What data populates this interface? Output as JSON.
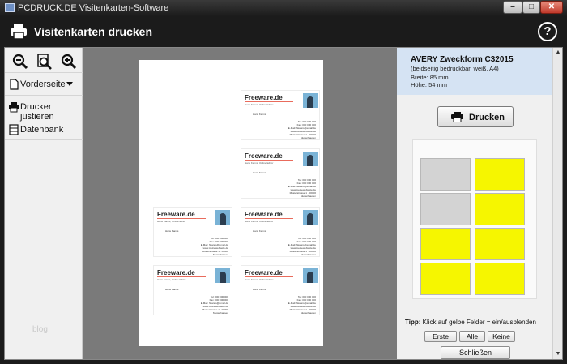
{
  "window": {
    "title": "PCDRUCK.DE Visitenkarten-Software",
    "min_label": "–",
    "max_label": "□",
    "close_label": "✕"
  },
  "header": {
    "title": "Visitenkarten drucken",
    "help_label": "?"
  },
  "sidebar": {
    "zoom_icons": [
      "zoom-out-icon",
      "zoom-fit-icon",
      "zoom-in-icon"
    ],
    "items": [
      {
        "label": "Vorderseite",
        "icon": "page-icon",
        "has_dropdown": true
      },
      {
        "label": "Drucker justieren",
        "icon": "printer-icon"
      },
      {
        "label": "Datenbank",
        "icon": "database-icon"
      }
    ],
    "watermark": "blog"
  },
  "card_template": {
    "title": "Freeware.de",
    "subtitle": "Hans Kanns, Online Editor",
    "name": "Hans Kanns",
    "info_lines": [
      "Tel: 000 000 000",
      "Fax: 000 000 000",
      "E-Mail: hkanns@email.de",
      "www.meinewebseite.de",
      "Musterstrasse 1 · 00000 Musterhausen"
    ]
  },
  "layout_panel": {
    "product_title": "AVERY Zweckform C32015",
    "product_subtitle": "(beidseitig bedruckbar, weiß, A4)",
    "width_text": "Breite: 85 mm",
    "height_text": "Höhe: 54 mm",
    "print_button": "Drucken",
    "fields": [
      {
        "row": 1,
        "col": 1,
        "active": false
      },
      {
        "row": 1,
        "col": 2,
        "active": true
      },
      {
        "row": 2,
        "col": 1,
        "active": false
      },
      {
        "row": 2,
        "col": 2,
        "active": true
      },
      {
        "row": 3,
        "col": 1,
        "active": true
      },
      {
        "row": 3,
        "col": 2,
        "active": true
      },
      {
        "row": 4,
        "col": 1,
        "active": true
      },
      {
        "row": 4,
        "col": 2,
        "active": true
      }
    ],
    "tip_label": "Tipp:",
    "tip_text": " Klick auf gelbe Felder = ein/ausblenden",
    "btn_first": "Erste",
    "btn_all": "Alle",
    "btn_none": "Keine",
    "btn_close": "Schließen"
  },
  "colors": {
    "active_field": "#f6f600",
    "inactive_field": "#d3d3d3",
    "info_bg": "#d5e3f3"
  }
}
